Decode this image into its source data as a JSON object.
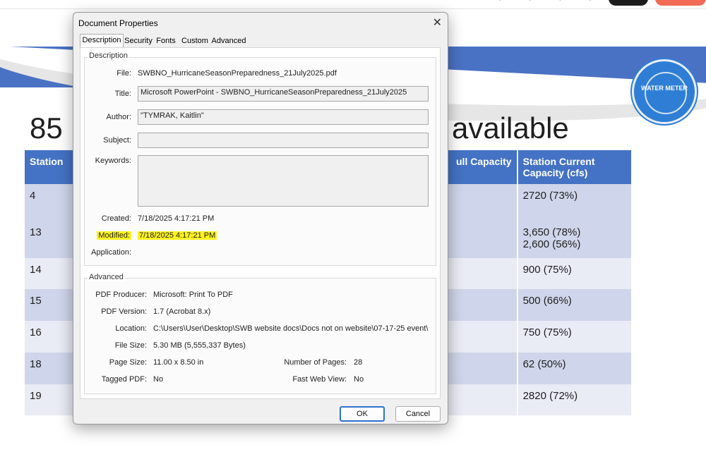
{
  "slide": {
    "title_left": "85",
    "title_right": "available",
    "logo_text": "WATER METER",
    "table": {
      "headers": [
        "Station",
        "",
        "ull Capacity",
        "Station Current Capacity (cfs)"
      ],
      "rows": [
        {
          "station": "4",
          "current": [
            "2720 (73%)"
          ]
        },
        {
          "station": "13",
          "current": [
            "3,650 (78%)",
            "2,600 (56%)"
          ]
        },
        {
          "station": "14",
          "current": [
            "900 (75%)"
          ]
        },
        {
          "station": "15",
          "current": [
            "500 (66%)"
          ]
        },
        {
          "station": "16",
          "current": [
            "750 (75%)"
          ]
        },
        {
          "station": "18",
          "current": [
            "62 (50%)"
          ]
        },
        {
          "station": "19",
          "current": [
            "2820 (72%)"
          ]
        }
      ]
    }
  },
  "dialog": {
    "title": "Document Properties",
    "tabs": [
      "Description",
      "Security",
      "Fonts",
      "Custom",
      "Advanced"
    ],
    "description": {
      "group_title": "Description",
      "file_label": "File:",
      "file_value": "SWBNO_HurricaneSeasonPreparedness_21July2025.pdf",
      "title_label": "Title:",
      "title_value": "Microsoft PowerPoint - SWBNO_HurricaneSeasonPreparedness_21July2025",
      "author_label": "Author:",
      "author_value": "\"TYMRAK, Kaitlin\"",
      "subject_label": "Subject:",
      "subject_value": "",
      "keywords_label": "Keywords:",
      "keywords_value": "",
      "created_label": "Created:",
      "created_value": "7/18/2025 4:17:21 PM",
      "modified_label": "Modified:",
      "modified_value": "7/18/2025 4:17:21 PM",
      "application_label": "Application:",
      "application_value": ""
    },
    "advanced": {
      "group_title": "Advanced",
      "pdf_producer_label": "PDF Producer:",
      "pdf_producer_value": "Microsoft: Print To PDF",
      "pdf_version_label": "PDF Version:",
      "pdf_version_value": "1.7 (Acrobat 8.x)",
      "location_label": "Location:",
      "location_value": "C:\\Users\\User\\Desktop\\SWB website docs\\Docs not on website\\07-17-25 event\\",
      "file_size_label": "File Size:",
      "file_size_value": "5.30 MB (5,555,337 Bytes)",
      "page_size_label": "Page Size:",
      "page_size_value": "11.00 x 8.50 in",
      "num_pages_label": "Number of Pages:",
      "num_pages_value": "28",
      "tagged_pdf_label": "Tagged PDF:",
      "tagged_pdf_value": "No",
      "fast_web_label": "Fast Web View:",
      "fast_web_value": "No"
    },
    "ok_label": "OK",
    "cancel_label": "Cancel"
  },
  "colors": {
    "slide_blue": "#4472c4",
    "row_dark": "#cfd5ea",
    "row_light": "#e9ebf5",
    "highlight": "#fff21e",
    "ok_border": "#2f72d1"
  }
}
